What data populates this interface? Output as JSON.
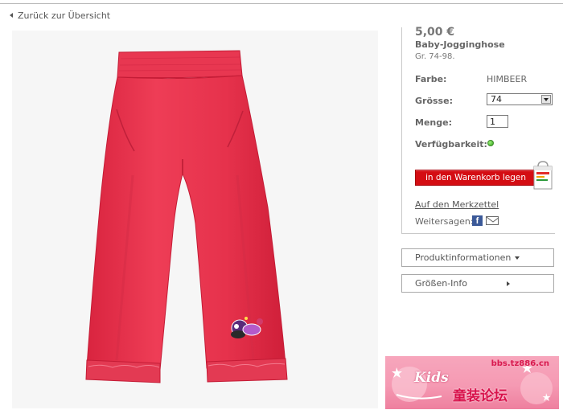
{
  "nav": {
    "back_label": "Zurück zur Übersicht"
  },
  "product": {
    "price": "5,00 €",
    "name": "Baby-Jogginghose",
    "size_range": "Gr. 74-98."
  },
  "options": {
    "color_label": "Farbe:",
    "color_value": "HIMBEER",
    "size_label": "Grösse:",
    "size_selected": "74",
    "qty_label": "Menge:",
    "qty_value": "1",
    "availability_label": "Verfügbarkeit:"
  },
  "actions": {
    "cart_button": "in den Warenkorb legen",
    "wishlist_link": "Auf den Merkzettel",
    "share_label": "Weitersagen:",
    "facebook_letter": "f"
  },
  "accordion": {
    "product_info": "Produktinformationen",
    "size_info": "Größen-Info"
  },
  "watermark": {
    "url": "bbs.tz886.cn",
    "kids": "Kids",
    "chinese": "童装论坛"
  },
  "colors": {
    "accent_red": "#d40d13",
    "pants_pink": "#e8344f",
    "availability_green": "#2fa21b",
    "facebook_blue": "#3b5998",
    "watermark_pink": "#f59ab3"
  },
  "icons": [
    "chevron-left-icon",
    "availability-dot-icon",
    "shopping-bag-icon",
    "facebook-icon",
    "email-icon",
    "chevron-down-icon",
    "chevron-right-icon"
  ]
}
